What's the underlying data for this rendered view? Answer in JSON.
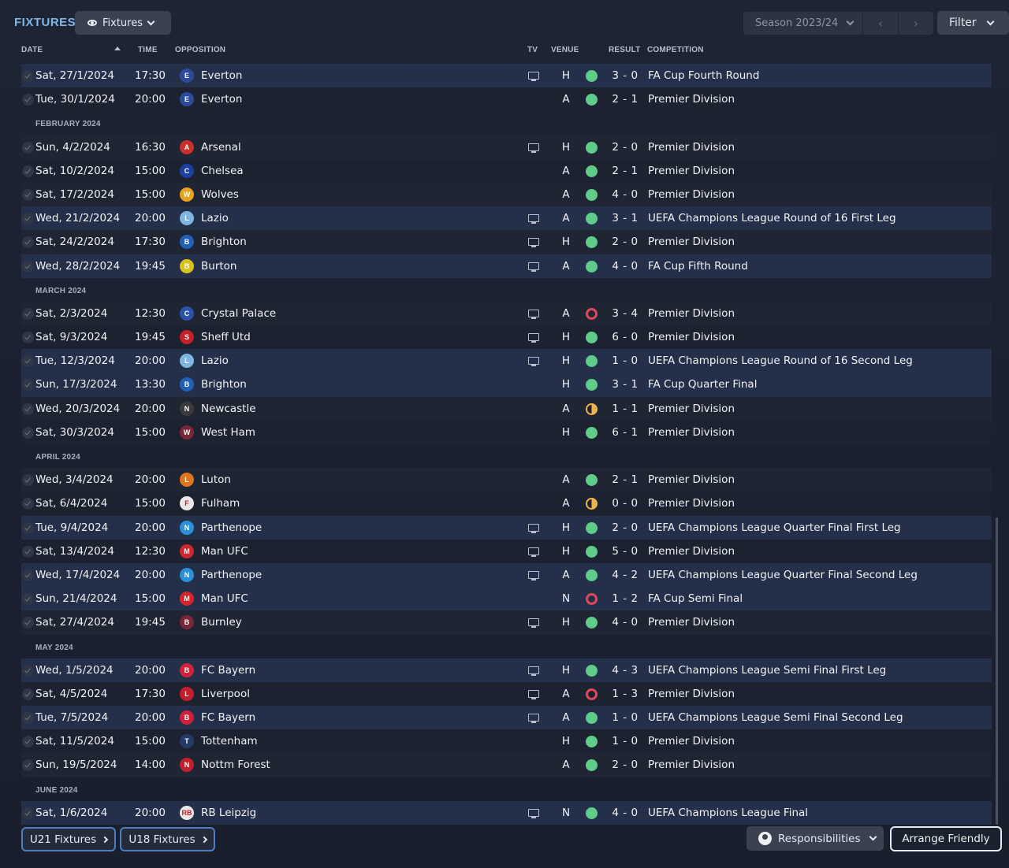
{
  "header": {
    "title": "FIXTURES",
    "view_label": "Fixtures",
    "season_label": "Season 2023/24",
    "filter_label": "Filter"
  },
  "columns": {
    "date": "DATE",
    "time": "TIME",
    "opposition": "OPPOSITION",
    "tv": "TV",
    "venue": "VENUE",
    "result": "RESULT",
    "competition": "COMPETITION"
  },
  "rows": [
    {
      "kind": "fixture",
      "date": "Sat, 27/1/2024",
      "time": "17:30",
      "opponent": "Everton",
      "tv": true,
      "venue": "H",
      "outcome": "W",
      "result": "3 - 0",
      "competition": "FA Cup Fourth Round",
      "hl": true,
      "badge_color": "#2c4a9a",
      "badge_text": "E"
    },
    {
      "kind": "fixture",
      "date": "Tue, 30/1/2024",
      "time": "20:00",
      "opponent": "Everton",
      "tv": false,
      "venue": "A",
      "outcome": "W",
      "result": "2 - 1",
      "competition": "Premier Division",
      "hl": false,
      "badge_color": "#2c4a9a",
      "badge_text": "E"
    },
    {
      "kind": "month",
      "label": "FEBRUARY 2024"
    },
    {
      "kind": "fixture",
      "date": "Sun, 4/2/2024",
      "time": "16:30",
      "opponent": "Arsenal",
      "tv": true,
      "venue": "H",
      "outcome": "W",
      "result": "2 - 0",
      "competition": "Premier Division",
      "hl": false,
      "badge_color": "#c9302c",
      "badge_text": "A"
    },
    {
      "kind": "fixture",
      "date": "Sat, 10/2/2024",
      "time": "15:00",
      "opponent": "Chelsea",
      "tv": false,
      "venue": "A",
      "outcome": "W",
      "result": "2 - 1",
      "competition": "Premier Division",
      "hl": false,
      "badge_color": "#1d3fa0",
      "badge_text": "C"
    },
    {
      "kind": "fixture",
      "date": "Sat, 17/2/2024",
      "time": "15:00",
      "opponent": "Wolves",
      "tv": false,
      "venue": "A",
      "outcome": "W",
      "result": "4 - 0",
      "competition": "Premier Division",
      "hl": false,
      "badge_color": "#e9a21b",
      "badge_text": "W"
    },
    {
      "kind": "fixture",
      "date": "Wed, 21/2/2024",
      "time": "20:00",
      "opponent": "Lazio",
      "tv": true,
      "venue": "A",
      "outcome": "W",
      "result": "3 - 1",
      "competition": "UEFA Champions League Round of 16  First Leg",
      "hl": true,
      "badge_color": "#7fb6e0",
      "badge_text": "L"
    },
    {
      "kind": "fixture",
      "date": "Sat, 24/2/2024",
      "time": "17:30",
      "opponent": "Brighton",
      "tv": true,
      "venue": "H",
      "outcome": "W",
      "result": "2 - 0",
      "competition": "Premier Division",
      "hl": false,
      "badge_color": "#1f5fb8",
      "badge_text": "B"
    },
    {
      "kind": "fixture",
      "date": "Wed, 28/2/2024",
      "time": "19:45",
      "opponent": "Burton",
      "tv": true,
      "venue": "A",
      "outcome": "W",
      "result": "4 - 0",
      "competition": "FA Cup Fifth Round",
      "hl": true,
      "badge_color": "#d8c21d",
      "badge_text": "B"
    },
    {
      "kind": "month",
      "label": "MARCH 2024"
    },
    {
      "kind": "fixture",
      "date": "Sat, 2/3/2024",
      "time": "12:30",
      "opponent": "Crystal Palace",
      "tv": true,
      "venue": "A",
      "outcome": "L",
      "result": "3 - 4",
      "competition": "Premier Division",
      "hl": false,
      "badge_color": "#2853a8",
      "badge_text": "C"
    },
    {
      "kind": "fixture",
      "date": "Sat, 9/3/2024",
      "time": "19:45",
      "opponent": "Sheff Utd",
      "tv": true,
      "venue": "H",
      "outcome": "W",
      "result": "6 - 0",
      "competition": "Premier Division",
      "hl": false,
      "badge_color": "#c8202b",
      "badge_text": "S"
    },
    {
      "kind": "fixture",
      "date": "Tue, 12/3/2024",
      "time": "20:00",
      "opponent": "Lazio",
      "tv": true,
      "venue": "H",
      "outcome": "W",
      "result": "1 - 0",
      "competition": "UEFA Champions League Round of 16  Second Leg",
      "hl": true,
      "badge_color": "#7fb6e0",
      "badge_text": "L"
    },
    {
      "kind": "fixture",
      "date": "Sun, 17/3/2024",
      "time": "13:30",
      "opponent": "Brighton",
      "tv": false,
      "venue": "H",
      "outcome": "W",
      "result": "3 - 1",
      "competition": "FA Cup Quarter Final",
      "hl": true,
      "badge_color": "#1f5fb8",
      "badge_text": "B"
    },
    {
      "kind": "fixture",
      "date": "Wed, 20/3/2024",
      "time": "20:00",
      "opponent": "Newcastle",
      "tv": false,
      "venue": "A",
      "outcome": "D",
      "result": "1 - 1",
      "competition": "Premier Division",
      "hl": false,
      "badge_color": "#3a3a3a",
      "badge_text": "N"
    },
    {
      "kind": "fixture",
      "date": "Sat, 30/3/2024",
      "time": "15:00",
      "opponent": "West Ham",
      "tv": false,
      "venue": "H",
      "outcome": "W",
      "result": "6 - 1",
      "competition": "Premier Division",
      "hl": false,
      "badge_color": "#7a2638",
      "badge_text": "W"
    },
    {
      "kind": "month",
      "label": "APRIL 2024"
    },
    {
      "kind": "fixture",
      "date": "Wed, 3/4/2024",
      "time": "20:00",
      "opponent": "Luton",
      "tv": false,
      "venue": "A",
      "outcome": "W",
      "result": "2 - 1",
      "competition": "Premier Division",
      "hl": false,
      "badge_color": "#e0751f",
      "badge_text": "L"
    },
    {
      "kind": "fixture",
      "date": "Sat, 6/4/2024",
      "time": "15:00",
      "opponent": "Fulham",
      "tv": false,
      "venue": "A",
      "outcome": "D",
      "result": "0 - 0",
      "competition": "Premier Division",
      "hl": false,
      "badge_color": "#e8e8e8",
      "badge_text": "F"
    },
    {
      "kind": "fixture",
      "date": "Tue, 9/4/2024",
      "time": "20:00",
      "opponent": "Parthenope",
      "tv": true,
      "venue": "H",
      "outcome": "W",
      "result": "2 - 0",
      "competition": "UEFA Champions League Quarter Final First Leg",
      "hl": true,
      "badge_color": "#2b8fd9",
      "badge_text": "N"
    },
    {
      "kind": "fixture",
      "date": "Sat, 13/4/2024",
      "time": "12:30",
      "opponent": "Man UFC",
      "tv": true,
      "venue": "H",
      "outcome": "W",
      "result": "5 - 0",
      "competition": "Premier Division",
      "hl": false,
      "badge_color": "#d1262b",
      "badge_text": "M"
    },
    {
      "kind": "fixture",
      "date": "Wed, 17/4/2024",
      "time": "20:00",
      "opponent": "Parthenope",
      "tv": true,
      "venue": "A",
      "outcome": "W",
      "result": "4 - 2",
      "competition": "UEFA Champions League Quarter Final Second Leg",
      "hl": true,
      "badge_color": "#2b8fd9",
      "badge_text": "N"
    },
    {
      "kind": "fixture",
      "date": "Sun, 21/4/2024",
      "time": "15:00",
      "opponent": "Man UFC",
      "tv": false,
      "venue": "N",
      "outcome": "L",
      "result": "1 - 2",
      "competition": "FA Cup Semi Final",
      "hl": true,
      "badge_color": "#d1262b",
      "badge_text": "M"
    },
    {
      "kind": "fixture",
      "date": "Sat, 27/4/2024",
      "time": "19:45",
      "opponent": "Burnley",
      "tv": true,
      "venue": "H",
      "outcome": "W",
      "result": "4 - 0",
      "competition": "Premier Division",
      "hl": false,
      "badge_color": "#7a2638",
      "badge_text": "B"
    },
    {
      "kind": "month",
      "label": "MAY 2024"
    },
    {
      "kind": "fixture",
      "date": "Wed, 1/5/2024",
      "time": "20:00",
      "opponent": "FC Bayern",
      "tv": true,
      "venue": "H",
      "outcome": "W",
      "result": "4 - 3",
      "competition": "UEFA Champions League Semi Final First Leg",
      "hl": true,
      "badge_color": "#d0203a",
      "badge_text": "B"
    },
    {
      "kind": "fixture",
      "date": "Sat, 4/5/2024",
      "time": "17:30",
      "opponent": "Liverpool",
      "tv": true,
      "venue": "A",
      "outcome": "L",
      "result": "1 - 3",
      "competition": "Premier Division",
      "hl": false,
      "badge_color": "#c61d2b",
      "badge_text": "L"
    },
    {
      "kind": "fixture",
      "date": "Tue, 7/5/2024",
      "time": "20:00",
      "opponent": "FC Bayern",
      "tv": true,
      "venue": "A",
      "outcome": "W",
      "result": "1 - 0",
      "competition": "UEFA Champions League Semi Final Second Leg",
      "hl": true,
      "badge_color": "#d0203a",
      "badge_text": "B"
    },
    {
      "kind": "fixture",
      "date": "Sat, 11/5/2024",
      "time": "15:00",
      "opponent": "Tottenham",
      "tv": false,
      "venue": "H",
      "outcome": "W",
      "result": "1 - 0",
      "competition": "Premier Division",
      "hl": false,
      "badge_color": "#243a66",
      "badge_text": "T"
    },
    {
      "kind": "fixture",
      "date": "Sun, 19/5/2024",
      "time": "14:00",
      "opponent": "Nottm Forest",
      "tv": false,
      "venue": "A",
      "outcome": "W",
      "result": "2 - 0",
      "competition": "Premier Division",
      "hl": false,
      "badge_color": "#c2202c",
      "badge_text": "N"
    },
    {
      "kind": "month",
      "label": "JUNE 2024"
    },
    {
      "kind": "fixture",
      "date": "Sat, 1/6/2024",
      "time": "20:00",
      "opponent": "RB Leipzig",
      "tv": true,
      "venue": "N",
      "outcome": "W",
      "result": "4 - 0",
      "competition": "UEFA Champions League Final",
      "hl": true,
      "badge_color": "#e8e8e8",
      "badge_text": "RB"
    }
  ],
  "footer": {
    "u21_label": "U21 Fixtures",
    "u18_label": "U18 Fixtures",
    "responsibilities_label": "Responsibilities",
    "arrange_label": "Arrange Friendly"
  }
}
